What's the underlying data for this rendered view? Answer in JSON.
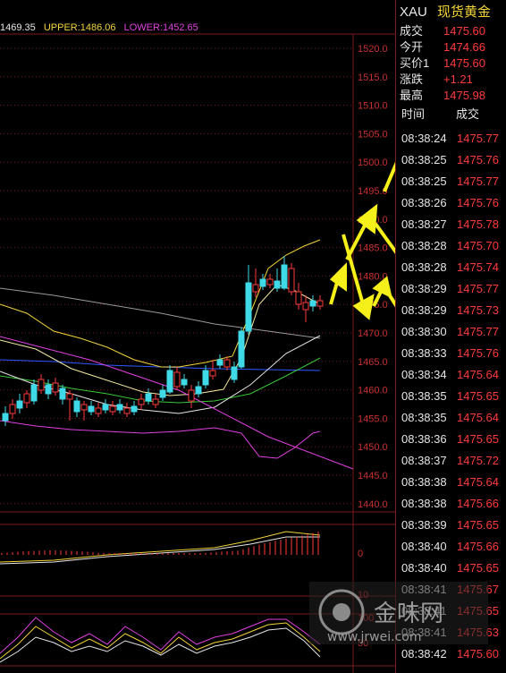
{
  "indicator_line": {
    "mid": "1469.35",
    "upper": "UPPER:1486.06",
    "lower": "LOWER:1452.65",
    "colors": {
      "mid": "#e6e6e6",
      "upper": "#f2d33a",
      "lower": "#e040e0"
    }
  },
  "price_axis": {
    "ticks": [
      "1520.0",
      "1515.0",
      "1510.0",
      "1505.0",
      "1500.0",
      "1495.0",
      "1490.0",
      "1485.0",
      "1480.0",
      "1475.0",
      "1470.0",
      "1465.0",
      "1460.0",
      "1455.0",
      "1450.0",
      "1445.0",
      "1440.0"
    ]
  },
  "macd_axis": {
    "ticks": [
      "0"
    ]
  },
  "kdj_axis": {
    "ticks": [
      "10",
      "100",
      "50"
    ]
  },
  "quote": {
    "symbol": "XAU",
    "name": "现货黄金",
    "rows": [
      {
        "label": "成交",
        "value": "1475.60"
      },
      {
        "label": "今开",
        "value": "1474.66"
      },
      {
        "label": "买价1",
        "value": "1475.60"
      },
      {
        "label": "涨跌",
        "value": "+1.21"
      },
      {
        "label": "最高",
        "value": "1475.98"
      }
    ]
  },
  "ticks_header": {
    "time": "时间",
    "price": "成交"
  },
  "ticks": [
    {
      "time": "08:38:24",
      "price": "1475.77"
    },
    {
      "time": "08:38:25",
      "price": "1475.76"
    },
    {
      "time": "08:38:25",
      "price": "1475.77"
    },
    {
      "time": "08:38:26",
      "price": "1475.76"
    },
    {
      "time": "08:38:27",
      "price": "1475.78"
    },
    {
      "time": "08:38:28",
      "price": "1475.70"
    },
    {
      "time": "08:38:28",
      "price": "1475.74"
    },
    {
      "time": "08:38:29",
      "price": "1475.77"
    },
    {
      "time": "08:38:29",
      "price": "1475.73"
    },
    {
      "time": "08:38:30",
      "price": "1475.77"
    },
    {
      "time": "08:38:33",
      "price": "1475.76"
    },
    {
      "time": "08:38:34",
      "price": "1475.64"
    },
    {
      "time": "08:38:35",
      "price": "1475.65"
    },
    {
      "time": "08:38:35",
      "price": "1475.64"
    },
    {
      "time": "08:38:36",
      "price": "1475.65"
    },
    {
      "time": "08:38:37",
      "price": "1475.72"
    },
    {
      "time": "08:38:38",
      "price": "1475.64"
    },
    {
      "time": "08:38:38",
      "price": "1475.66"
    },
    {
      "time": "08:38:39",
      "price": "1475.65"
    },
    {
      "time": "08:38:40",
      "price": "1475.66"
    },
    {
      "time": "08:38:40",
      "price": "1475.65"
    },
    {
      "time": "08:38:41",
      "price": "1475.67"
    },
    {
      "time": "08:38:41",
      "price": "1475.65"
    },
    {
      "time": "08:38:41",
      "price": "1475.63"
    },
    {
      "time": "08:38:42",
      "price": "1475.60"
    }
  ],
  "watermark": {
    "text": "金味网",
    "url": "www.jrwei.com"
  },
  "colors": {
    "up": "#ff3b3b",
    "down": "#3fd9e8",
    "arrow": "#f6f01a",
    "grid": "#7a1a1a",
    "axis_text": "#c83030"
  }
}
